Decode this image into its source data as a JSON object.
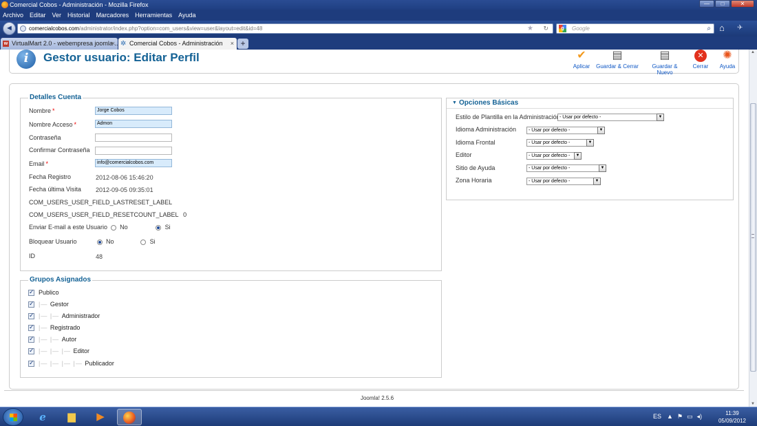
{
  "window": {
    "title": "Comercial Cobos - Administración - Mozilla Firefox",
    "minimize": "—",
    "maximize": "□",
    "close": "✕"
  },
  "menu": [
    "Archivo",
    "Editar",
    "Ver",
    "Historial",
    "Marcadores",
    "Herramientas",
    "Ayuda"
  ],
  "nav": {
    "url_host": "comercialcobos.com",
    "url_path": "/administrator/index.php?option=com_users&view=user&layout=edit&id=48",
    "search_placeholder": "Google"
  },
  "tabs": [
    {
      "label": "VirtualMart 2.0 - webempresa joomla ..."
    },
    {
      "label": "Comercial Cobos - Administración"
    }
  ],
  "page": {
    "title": "Gestor usuario: Editar Perfil",
    "toolbar": [
      {
        "label": "Aplicar",
        "icon": "check-icon"
      },
      {
        "label": "Guardar & Cerrar",
        "icon": "save-icon"
      },
      {
        "label": "Guardar & Nuevo",
        "icon": "save-new-icon"
      },
      {
        "label": "Cerrar",
        "icon": "close-icon"
      },
      {
        "label": "Ayuda",
        "icon": "help-icon"
      }
    ]
  },
  "account": {
    "legend": "Detalles Cuenta",
    "name_label": "Nombre",
    "name_value": "Jorge Cobos",
    "username_label": "Nombre Acceso",
    "username_value": "Admon",
    "password_label": "Contraseña",
    "password2_label": "Confirmar Contraseña",
    "email_label": "Email",
    "email_value": "info@comercialcobos.com",
    "registered_label": "Fecha Registro",
    "registered_value": "2012-08-06 15:46:20",
    "lastvisit_label": "Fecha última Visita",
    "lastvisit_value": "2012-09-05 09:35:01",
    "lastreset_label": "COM_USERS_USER_FIELD_LASTRESET_LABEL",
    "resetcount_label": "COM_USERS_USER_FIELD_RESETCOUNT_LABEL",
    "resetcount_value": "0",
    "sendemail_label": "Enviar E-mail a este Usuario",
    "block_label": "Bloquear Usuario",
    "no": "No",
    "si": "Si",
    "id_label": "ID",
    "id_value": "48"
  },
  "groups": {
    "legend": "Grupos Asignados",
    "items": [
      {
        "label": "Publico",
        "depth": 0
      },
      {
        "label": "Gestor",
        "depth": 1
      },
      {
        "label": "Administrador",
        "depth": 2
      },
      {
        "label": "Registrado",
        "depth": 1
      },
      {
        "label": "Autor",
        "depth": 2
      },
      {
        "label": "Editor",
        "depth": 3
      },
      {
        "label": "Publicador",
        "depth": 4
      }
    ]
  },
  "options": {
    "title": "Opciones Básicas",
    "rows": [
      {
        "label": "Estilo de Plantilla en la Administración",
        "value": "- Usar por defecto -"
      },
      {
        "label": "Idioma Administración",
        "value": "- Usar por defecto -"
      },
      {
        "label": "Idioma Frontal",
        "value": "- Usar por defecto -"
      },
      {
        "label": "Editor",
        "value": "- Usar por defecto -"
      },
      {
        "label": "Sitio de Ayuda",
        "value": "- Usar por defecto -"
      },
      {
        "label": "Zona Horaria",
        "value": "- Usar por defecto -"
      }
    ]
  },
  "footer": {
    "version": "Joomla! 2.5.6"
  },
  "taskbar": {
    "lang": "ES",
    "time": "11:39",
    "date": "05/09/2012"
  }
}
